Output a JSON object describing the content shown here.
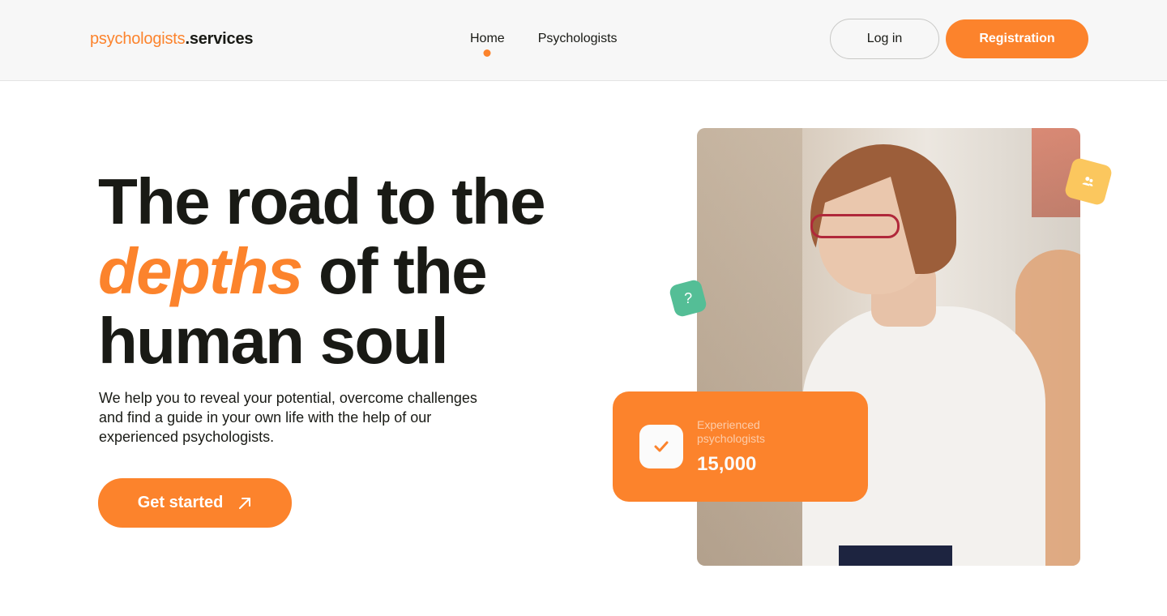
{
  "header": {
    "logo_part1": "psychologists",
    "logo_part2": ".services",
    "nav": [
      {
        "label": "Home",
        "active": true
      },
      {
        "label": "Psychologists",
        "active": false
      }
    ],
    "login_label": "Log in",
    "registration_label": "Registration"
  },
  "hero": {
    "title_line1": "The road to the",
    "title_accent": "depths",
    "title_line2_rest": " of the",
    "title_line3": "human soul",
    "subtitle": "We help you to reveal your potential, overcome challenges and find a guide in your own life with the help of our experienced psychologists.",
    "cta_label": "Get started"
  },
  "badges": {
    "question": "?",
    "people_icon": "users-icon"
  },
  "stat_card": {
    "label": "Experienced psychologists",
    "value": "15,000",
    "icon": "check-icon"
  },
  "colors": {
    "accent": "#fc832c",
    "yellow": "#fbc75e",
    "green": "#54be96",
    "text": "#191a15"
  }
}
